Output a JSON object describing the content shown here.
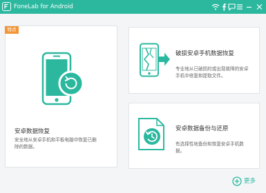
{
  "window": {
    "title": "FoneLab for Android",
    "icons": [
      "wifi-icon",
      "facebook-icon",
      "chat-icon",
      "menu-icon",
      "minimize-icon",
      "close-icon"
    ]
  },
  "colors": {
    "brand": "#2bb89f",
    "badge": "#f29637",
    "text": "#333333",
    "muted": "#666666"
  },
  "main_card": {
    "badge": "特点",
    "title": "安卓数据恢复",
    "desc_lines": [
      "安全地从安卓手机和平板电脑中恢复已删",
      "除的数据。"
    ]
  },
  "card_broken": {
    "title": "破损安卓手机数据恢复",
    "desc_lines": [
      "专业地从已破损的或出现故障的安卓",
      "手机中修复和提取文件。"
    ]
  },
  "card_backup": {
    "title": "安卓数据备份与还原",
    "desc_lines": [
      "有选择性地备份和恢复安卓手机数",
      "据。"
    ]
  },
  "footer": {
    "more_label": "更多"
  }
}
